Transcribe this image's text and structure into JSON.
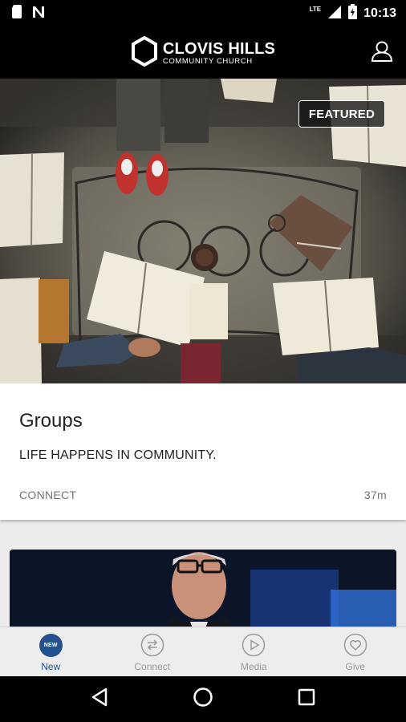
{
  "status_bar": {
    "time": "10:13",
    "network": "LTE",
    "icons": [
      "sim-card-icon",
      "notification-n-icon",
      "signal-icon",
      "battery-charging-icon"
    ]
  },
  "header": {
    "logo_line1": "CLOVIS HILLS",
    "logo_line2": "COMMUNITY CHURCH",
    "profile_icon": "user-profile-icon"
  },
  "featured_card": {
    "badge": "FEATURED",
    "title": "Groups",
    "subtitle": "LIFE HAPPENS IN COMMUNITY.",
    "category": "CONNECT",
    "time_ago": "37m"
  },
  "tabs": [
    {
      "label": "New",
      "icon": "new-badge-icon",
      "badge_text": "NEW",
      "active": true
    },
    {
      "label": "Connect",
      "icon": "connect-arrows-icon",
      "active": false
    },
    {
      "label": "Media",
      "icon": "play-icon",
      "active": false
    },
    {
      "label": "Give",
      "icon": "heart-icon",
      "active": false
    }
  ],
  "nav": {
    "icons": [
      "back-triangle-icon",
      "home-circle-icon",
      "recents-square-icon"
    ]
  },
  "colors": {
    "accent": "#23528f",
    "inactive": "#9a9a9a",
    "header_bg": "#000000"
  }
}
